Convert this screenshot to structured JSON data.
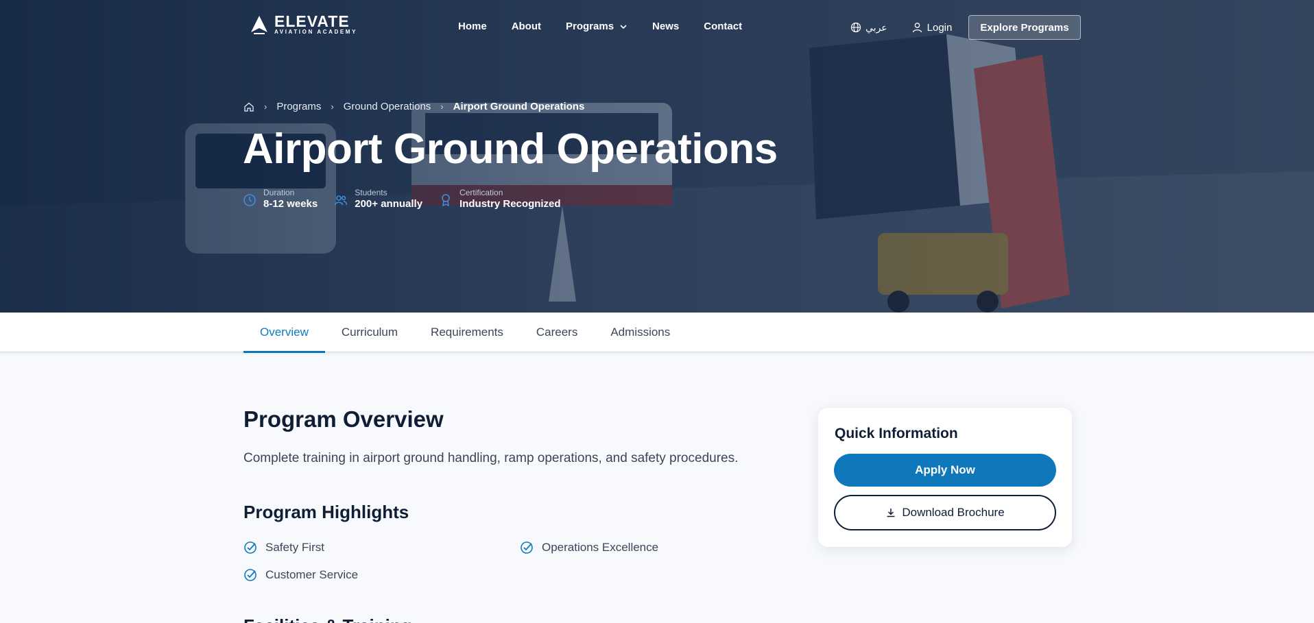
{
  "brand": {
    "name": "ELEVATE",
    "tagline": "AVIATION ACADEMY"
  },
  "nav": {
    "links": [
      "Home",
      "About",
      "Programs",
      "News",
      "Contact"
    ],
    "language_label": "عربي",
    "login_label": "Login",
    "cta_label": "Explore Programs"
  },
  "breadcrumb": [
    "Programs",
    "Ground Operations",
    "Airport Ground Operations"
  ],
  "hero": {
    "title": "Airport Ground Operations",
    "stats": [
      {
        "label": "Duration",
        "value": "8-12 weeks",
        "icon": "clock-icon"
      },
      {
        "label": "Students",
        "value": "200+ annually",
        "icon": "users-icon"
      },
      {
        "label": "Certification",
        "value": "Industry Recognized",
        "icon": "award-icon"
      }
    ]
  },
  "tabs": [
    "Overview",
    "Curriculum",
    "Requirements",
    "Careers",
    "Admissions"
  ],
  "active_tab": "Overview",
  "overview": {
    "title": "Program Overview",
    "description": "Complete training in airport ground handling, ramp operations, and safety procedures."
  },
  "highlights": {
    "title": "Program Highlights",
    "items": [
      "Safety First",
      "Operations Excellence",
      "Customer Service"
    ]
  },
  "next_section_title": "Facilities & Training",
  "quick_info": {
    "title": "Quick Information",
    "apply_label": "Apply Now",
    "brochure_label": "Download Brochure"
  },
  "colors": {
    "primary": "#0e78ba",
    "navy": "#0f1e35",
    "hero_overlay": "#12284a",
    "background": "#f7f9fc"
  }
}
